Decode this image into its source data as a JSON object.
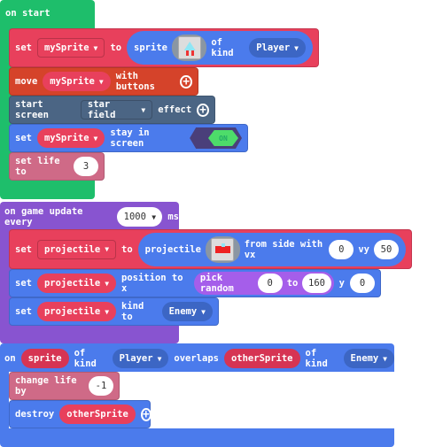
{
  "on_start": {
    "label": "on start",
    "set_sprite": {
      "set": "set",
      "var": "mySprite",
      "to": "to",
      "sprite": "sprite",
      "of_kind": "of kind",
      "kind": "Player"
    },
    "move": {
      "move": "move",
      "var": "mySprite",
      "with": "with buttons"
    },
    "screen": {
      "start": "start screen",
      "effect_name": "star field",
      "effect": "effect"
    },
    "stay": {
      "set": "set",
      "var": "mySprite",
      "stay": "stay in screen",
      "toggle": "ON"
    },
    "life": {
      "label": "set life to",
      "value": "3"
    }
  },
  "game_update": {
    "label": "on game update every",
    "interval": "1000",
    "ms": "ms",
    "set_proj": {
      "set": "set",
      "var": "projectile",
      "to": "to",
      "projectile": "projectile",
      "from": "from side with vx",
      "vx": "0",
      "vy_label": "vy",
      "vy": "50"
    },
    "position": {
      "set": "set",
      "var": "projectile",
      "pos": "position to x",
      "pick": "pick random",
      "min": "0",
      "to": "to",
      "max": "160",
      "y_label": "y",
      "y": "0"
    },
    "kind": {
      "set": "set",
      "var": "projectile",
      "kind_to": "kind to",
      "kind": "Enemy"
    }
  },
  "overlap": {
    "on": "on",
    "sprite": "sprite",
    "of_kind": "of kind",
    "kind1": "Player",
    "overlaps": "overlaps",
    "other": "otherSprite",
    "of_kind2": "of kind",
    "kind2": "Enemy",
    "change": {
      "label": "change life by",
      "value": "-1"
    },
    "destroy": {
      "label": "destroy",
      "var": "otherSprite"
    }
  },
  "colors": {
    "loops": "#1ebe6b",
    "sprites": "#4b7bec",
    "variables": "#e8405c",
    "controller": "#d5432a",
    "scene": "#4b6584",
    "info": "#cf6a87",
    "game": "#8854d0",
    "math": "#a55eea"
  }
}
